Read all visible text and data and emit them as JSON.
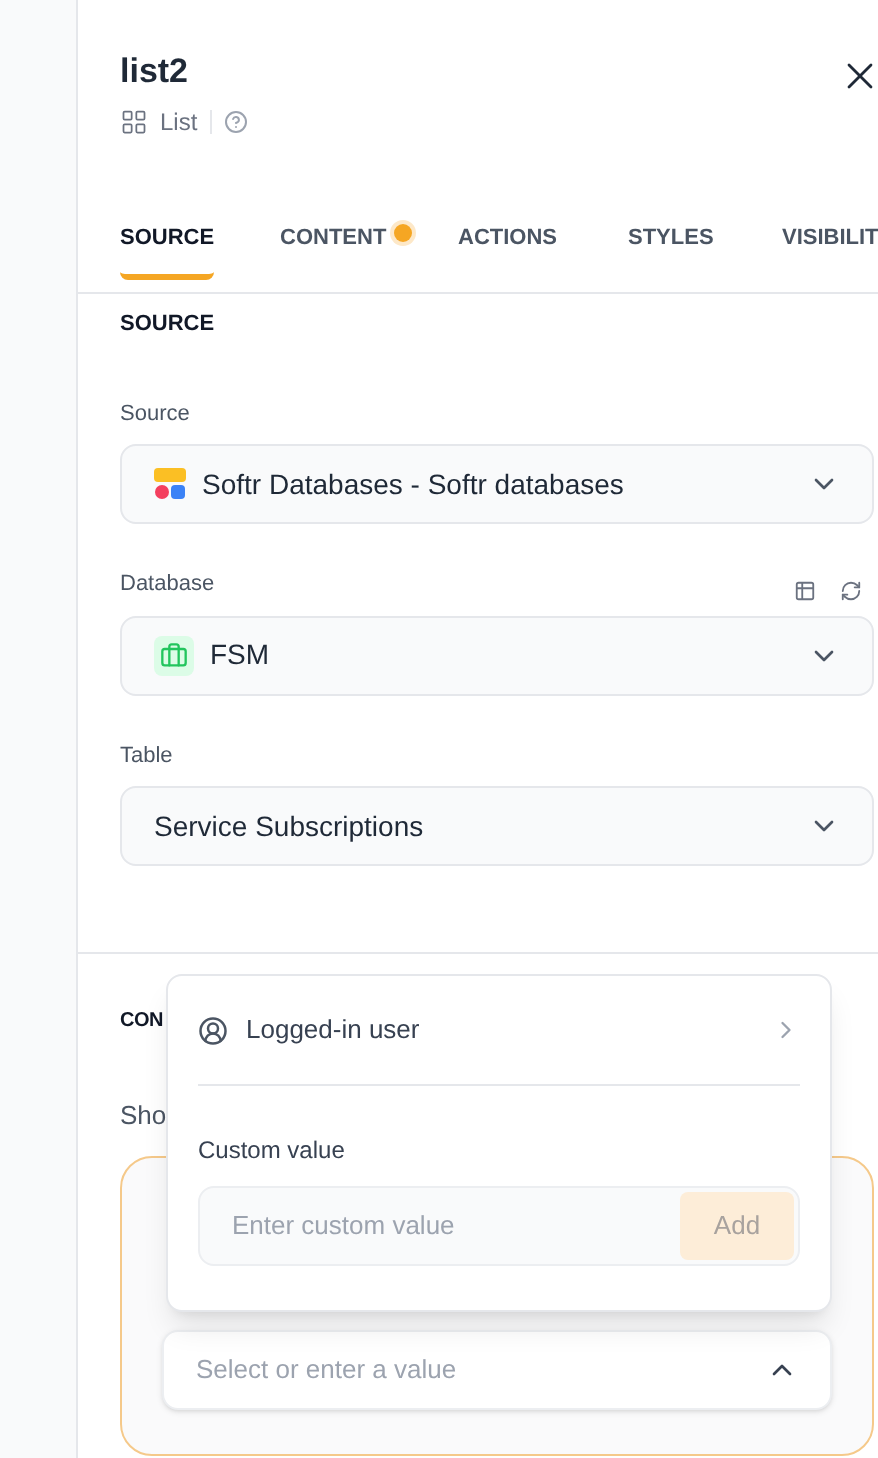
{
  "header": {
    "title": "list2",
    "type_label": "List"
  },
  "tabs": [
    {
      "label": "SOURCE",
      "selected": true,
      "badge": false
    },
    {
      "label": "CONTENT",
      "selected": false,
      "badge": true
    },
    {
      "label": "ACTIONS",
      "selected": false,
      "badge": false
    },
    {
      "label": "STYLES",
      "selected": false,
      "badge": false
    },
    {
      "label": "VISIBILIT",
      "selected": false,
      "badge": false
    }
  ],
  "section_heading": "SOURCE",
  "fields": [
    {
      "label": "Source",
      "value": "Softr Databases - Softr databases",
      "kind": "softr",
      "tools": false
    },
    {
      "label": "Database",
      "value": "FSM",
      "kind": "database",
      "tools": true
    },
    {
      "label": "Table",
      "value": "Service Subscriptions",
      "kind": "plain",
      "tools": false
    }
  ],
  "lower_section": {
    "heading": "CON",
    "text": "Sho",
    "select_placeholder": "Select or enter a value",
    "expanded": true
  },
  "popup": {
    "option": "Logged-in user",
    "custom_label": "Custom value",
    "custom_placeholder": "Enter custom value",
    "add_button": "Add",
    "add_disabled": true
  }
}
